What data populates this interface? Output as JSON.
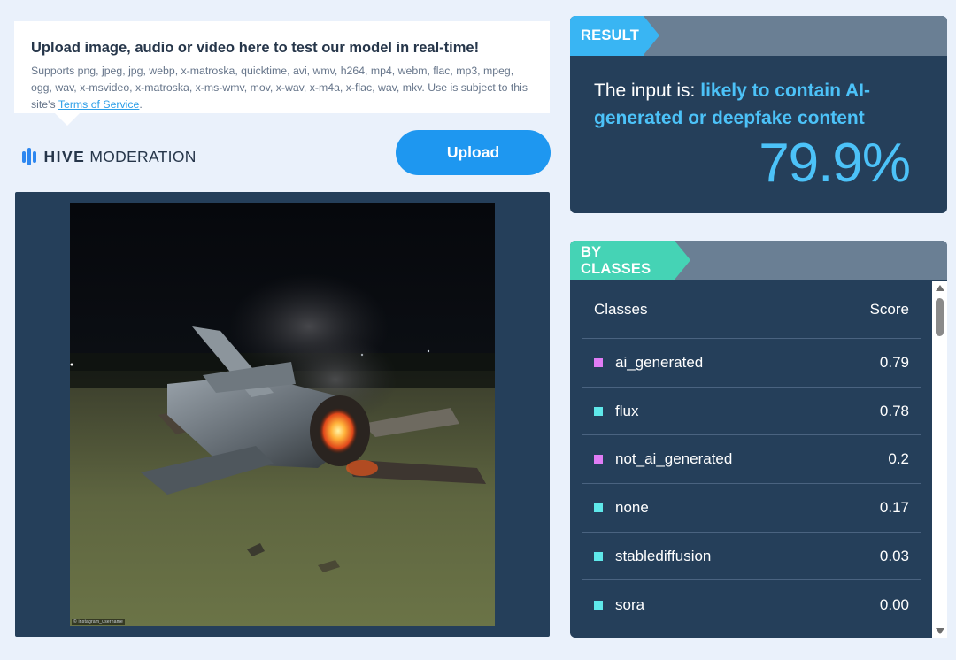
{
  "info": {
    "title": "Upload image, audio or video here to test our model in real-time!",
    "supports": "Supports png, jpeg, jpg, webp, x-matroska, quicktime, avi, wmv, h264, mp4, webm, flac, mp3, mpeg, ogg, wav, x-msvideo, x-matroska, x-ms-wmv, mov, x-wav, x-m4a, x-flac, wav, mkv. Use is subject to this site's ",
    "terms_link": "Terms of Service",
    "terms_suffix": "."
  },
  "brand": {
    "hive": "HIVE",
    "moderation": "MODERATION",
    "icon": "hive-logo-icon"
  },
  "upload": {
    "label": "Upload"
  },
  "preview": {
    "image_description": "burned-fighter-jet-photo",
    "watermark": "© instagram_username"
  },
  "result": {
    "tag": "RESULT",
    "prefix": "The input is: ",
    "verdict": "likely to contain AI-generated or deepfake content",
    "percent": "79.9%"
  },
  "classes": {
    "tag": "BY CLASSES",
    "header_class": "Classes",
    "header_score": "Score",
    "rows": [
      {
        "name": "ai_generated",
        "score": "0.79",
        "color": "#e07cf5"
      },
      {
        "name": "flux",
        "score": "0.78",
        "color": "#5fe8ea"
      },
      {
        "name": "not_ai_generated",
        "score": "0.2",
        "color": "#e07cf5"
      },
      {
        "name": "none",
        "score": "0.17",
        "color": "#5fe8ea"
      },
      {
        "name": "stablediffusion",
        "score": "0.03",
        "color": "#5fe8ea"
      },
      {
        "name": "sora",
        "score": "0.00",
        "color": "#5fe8ea"
      }
    ]
  },
  "colors": {
    "accent_blue": "#39b5f3",
    "accent_green": "#45d3b5",
    "panel_bg": "#253f5a",
    "highlight": "#4cc2f8",
    "button": "#1e97f0"
  }
}
